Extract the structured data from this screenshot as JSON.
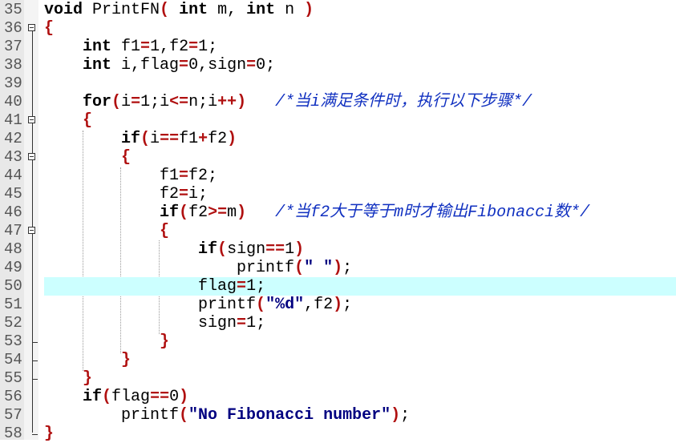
{
  "editor": {
    "highlight_color": "#ccffff",
    "highlighted_line": 50,
    "lines": [
      {
        "n": "35",
        "t": [
          [
            "kw",
            "void"
          ],
          [
            "tx",
            " PrintFN"
          ],
          [
            "op",
            "("
          ],
          [
            "tx",
            " "
          ],
          [
            "kw",
            "int"
          ],
          [
            "tx",
            " m, "
          ],
          [
            "kw",
            "int"
          ],
          [
            "tx",
            " n "
          ],
          [
            "op",
            ")"
          ]
        ]
      },
      {
        "n": "36",
        "fold": "open",
        "t": [
          [
            "op",
            "{"
          ]
        ]
      },
      {
        "n": "37",
        "t": [
          [
            "tx",
            "    "
          ],
          [
            "kw",
            "int"
          ],
          [
            "tx",
            " f1"
          ],
          [
            "op",
            "="
          ],
          [
            "tx",
            "1,f2"
          ],
          [
            "op",
            "="
          ],
          [
            "tx",
            "1;"
          ]
        ]
      },
      {
        "n": "38",
        "t": [
          [
            "tx",
            "    "
          ],
          [
            "kw",
            "int"
          ],
          [
            "tx",
            " i,flag"
          ],
          [
            "op",
            "="
          ],
          [
            "tx",
            "0,sign"
          ],
          [
            "op",
            "="
          ],
          [
            "tx",
            "0;"
          ]
        ]
      },
      {
        "n": "39",
        "t": []
      },
      {
        "n": "40",
        "t": [
          [
            "tx",
            "    "
          ],
          [
            "kw",
            "for"
          ],
          [
            "op",
            "("
          ],
          [
            "tx",
            "i"
          ],
          [
            "op",
            "="
          ],
          [
            "tx",
            "1;i"
          ],
          [
            "op",
            "<="
          ],
          [
            "tx",
            "n;i"
          ],
          [
            "op",
            "++"
          ],
          [
            "op",
            ")"
          ],
          [
            "tx",
            "   "
          ],
          [
            "cm",
            "/*当i满足条件时，执行以下步骤*/"
          ]
        ]
      },
      {
        "n": "41",
        "fold": "open",
        "t": [
          [
            "tx",
            "    "
          ],
          [
            "op",
            "{"
          ]
        ]
      },
      {
        "n": "42",
        "t": [
          [
            "tx",
            "        "
          ],
          [
            "kw",
            "if"
          ],
          [
            "op",
            "("
          ],
          [
            "tx",
            "i"
          ],
          [
            "op",
            "=="
          ],
          [
            "tx",
            "f1"
          ],
          [
            "op",
            "+"
          ],
          [
            "tx",
            "f2"
          ],
          [
            "op",
            ")"
          ]
        ]
      },
      {
        "n": "43",
        "fold": "open",
        "t": [
          [
            "tx",
            "        "
          ],
          [
            "op",
            "{"
          ]
        ]
      },
      {
        "n": "44",
        "t": [
          [
            "tx",
            "            f1"
          ],
          [
            "op",
            "="
          ],
          [
            "tx",
            "f2;"
          ]
        ]
      },
      {
        "n": "45",
        "t": [
          [
            "tx",
            "            f2"
          ],
          [
            "op",
            "="
          ],
          [
            "tx",
            "i;"
          ]
        ]
      },
      {
        "n": "46",
        "t": [
          [
            "tx",
            "            "
          ],
          [
            "kw",
            "if"
          ],
          [
            "op",
            "("
          ],
          [
            "tx",
            "f2"
          ],
          [
            "op",
            ">="
          ],
          [
            "tx",
            "m"
          ],
          [
            "op",
            ")"
          ],
          [
            "tx",
            "   "
          ],
          [
            "cm",
            "/*当f2大于等于m时才输出Fibonacci数*/"
          ]
        ]
      },
      {
        "n": "47",
        "fold": "open",
        "t": [
          [
            "tx",
            "            "
          ],
          [
            "op",
            "{"
          ]
        ]
      },
      {
        "n": "48",
        "t": [
          [
            "tx",
            "                "
          ],
          [
            "kw",
            "if"
          ],
          [
            "op",
            "("
          ],
          [
            "tx",
            "sign"
          ],
          [
            "op",
            "=="
          ],
          [
            "tx",
            "1"
          ],
          [
            "op",
            ")"
          ]
        ]
      },
      {
        "n": "49",
        "t": [
          [
            "tx",
            "                    printf"
          ],
          [
            "op",
            "("
          ],
          [
            "str",
            "\" \""
          ],
          [
            "op",
            ")"
          ],
          [
            "tx",
            ";"
          ]
        ]
      },
      {
        "n": "50",
        "t": [
          [
            "tx",
            "                flag"
          ],
          [
            "op",
            "="
          ],
          [
            "tx",
            "1;"
          ]
        ]
      },
      {
        "n": "51",
        "t": [
          [
            "tx",
            "                printf"
          ],
          [
            "op",
            "("
          ],
          [
            "str",
            "\"%d\""
          ],
          [
            "tx",
            ",f2"
          ],
          [
            "op",
            ")"
          ],
          [
            "tx",
            ";"
          ]
        ]
      },
      {
        "n": "52",
        "t": [
          [
            "tx",
            "                sign"
          ],
          [
            "op",
            "="
          ],
          [
            "tx",
            "1;"
          ]
        ]
      },
      {
        "n": "53",
        "fold": "end",
        "t": [
          [
            "tx",
            "            "
          ],
          [
            "op",
            "}"
          ]
        ]
      },
      {
        "n": "54",
        "fold": "end",
        "t": [
          [
            "tx",
            "        "
          ],
          [
            "op",
            "}"
          ]
        ]
      },
      {
        "n": "55",
        "fold": "end",
        "t": [
          [
            "tx",
            "    "
          ],
          [
            "op",
            "}"
          ]
        ]
      },
      {
        "n": "56",
        "t": [
          [
            "tx",
            "    "
          ],
          [
            "kw",
            "if"
          ],
          [
            "op",
            "("
          ],
          [
            "tx",
            "flag"
          ],
          [
            "op",
            "=="
          ],
          [
            "tx",
            "0"
          ],
          [
            "op",
            ")"
          ]
        ]
      },
      {
        "n": "57",
        "t": [
          [
            "tx",
            "        printf"
          ],
          [
            "op",
            "("
          ],
          [
            "str",
            "\"No Fibonacci number\""
          ],
          [
            "op",
            ")"
          ],
          [
            "tx",
            ";"
          ]
        ]
      },
      {
        "n": "58",
        "fold": "last",
        "t": [
          [
            "op",
            "}"
          ]
        ]
      }
    ]
  }
}
